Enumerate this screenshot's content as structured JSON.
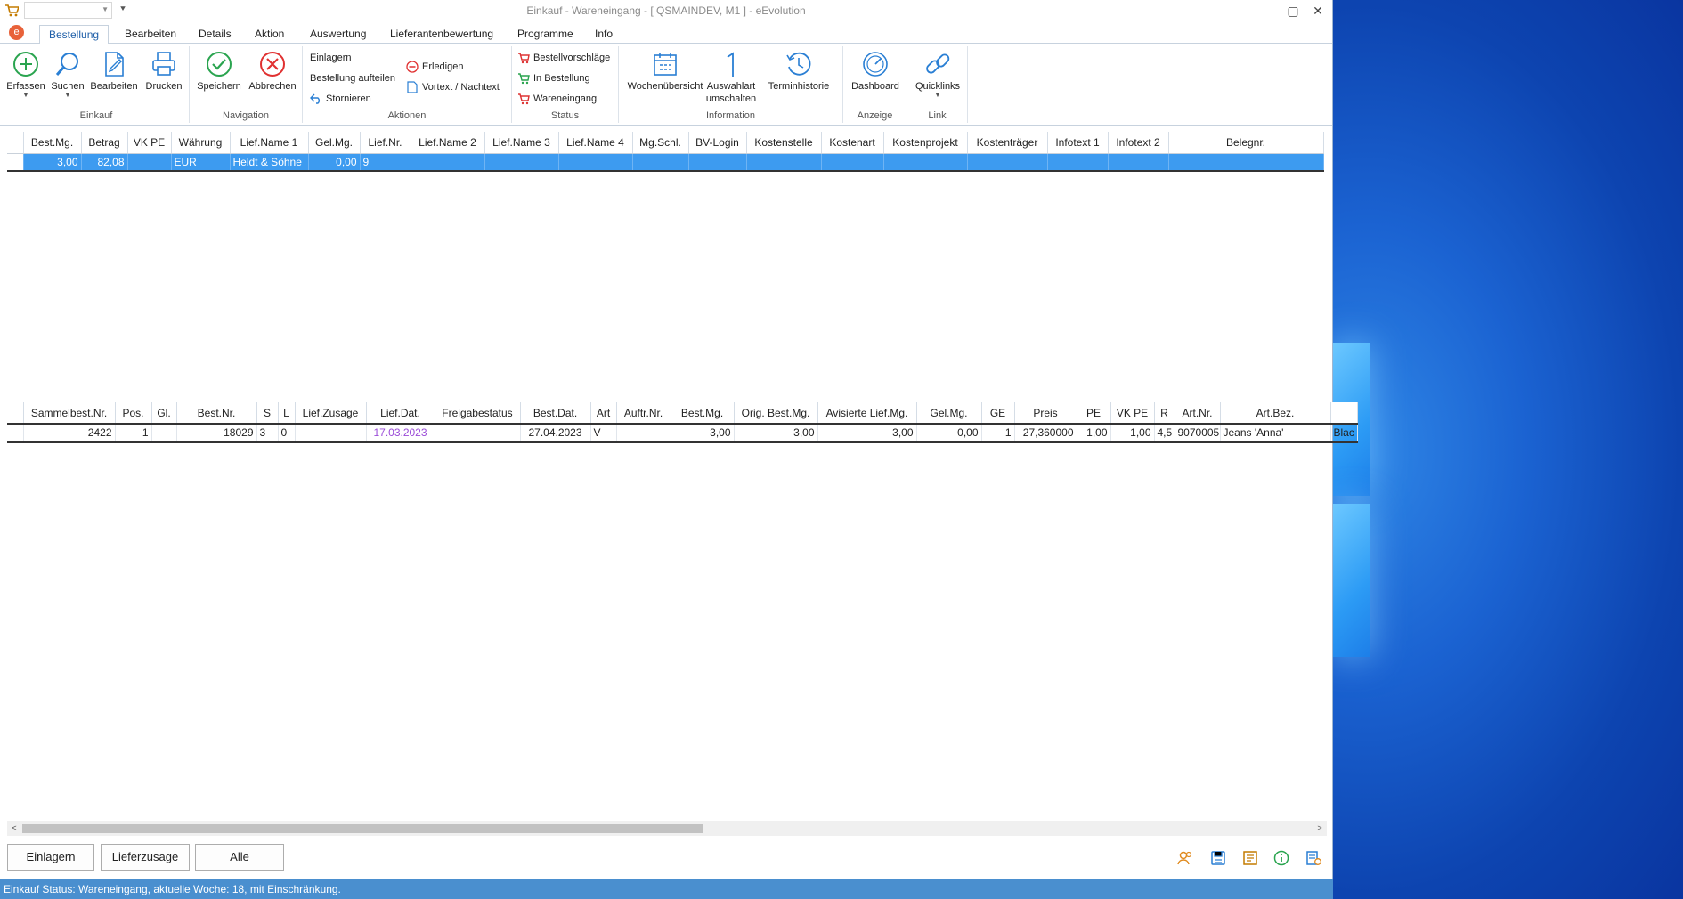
{
  "window": {
    "title": "Einkauf - Wareneingang - [ QSMAINDEV, M1 ]  -  eEvolution",
    "min": "—",
    "max": "▢",
    "close": "✕"
  },
  "qat": {
    "combo_value": ""
  },
  "tabs": [
    {
      "label": "Bestellung",
      "active": true
    },
    {
      "label": "Bearbeiten"
    },
    {
      "label": "Details"
    },
    {
      "label": "Aktion"
    },
    {
      "label": "Auswertung"
    },
    {
      "label": "Lieferantenbewertung"
    },
    {
      "label": "Programme"
    },
    {
      "label": "Info"
    }
  ],
  "ribbon": {
    "einkauf": {
      "label": "Einkauf",
      "erfassen": "Erfassen",
      "suchen": "Suchen",
      "bearbeiten": "Bearbeiten",
      "drucken": "Drucken"
    },
    "navigation": {
      "label": "Navigation",
      "speichern": "Speichern",
      "abbrechen": "Abbrechen"
    },
    "aktionen": {
      "label": "Aktionen",
      "einlagern": "Einlagern",
      "aufteilen": "Bestellung aufteilen",
      "stornieren": "Stornieren",
      "erledigen": "Erledigen",
      "vortext": "Vortext / Nachtext"
    },
    "status": {
      "label": "Status",
      "vorschlaege": "Bestellvorschläge",
      "in_bestellung": "In Bestellung",
      "wareneingang": "Wareneingang"
    },
    "information": {
      "label": "Information",
      "wochen": "Wochenübersicht",
      "auswahlart_1": "Auswahlart",
      "auswahlart_2": "umschalten",
      "termin": "Terminhistorie"
    },
    "anzeige": {
      "label": "Anzeige",
      "dashboard": "Dashboard"
    },
    "link": {
      "label": "Link",
      "quicklinks": "Quicklinks"
    }
  },
  "top_grid": {
    "columns": [
      "Best.Mg.",
      "Betrag",
      "VK PE",
      "Währung",
      "Lief.Name 1",
      "Gel.Mg.",
      "Lief.Nr.",
      "Lief.Name 2",
      "Lief.Name 3",
      "Lief.Name 4",
      "Mg.Schl.",
      "BV-Login",
      "Kostenstelle",
      "Kostenart",
      "Kostenprojekt",
      "Kostenträger",
      "Infotext 1",
      "Infotext 2",
      "Belegnr."
    ],
    "row": [
      "3,00",
      "82,08",
      "",
      "EUR",
      "Heldt & Söhne",
      "0,00",
      "9",
      "",
      "",
      "",
      "",
      "",
      "",
      "",
      "",
      "",
      "",
      "",
      ""
    ]
  },
  "bottom_grid": {
    "columns": [
      "Sammelbest.Nr.",
      "Pos.",
      "Gl.",
      "Best.Nr.",
      "S",
      "L",
      "Lief.Zusage",
      "Lief.Dat.",
      "Freigabestatus",
      "Best.Dat.",
      "Art",
      "Auftr.Nr.",
      "Best.Mg.",
      "Orig. Best.Mg.",
      "Avisierte Lief.Mg.",
      "Gel.Mg.",
      "GE",
      "Preis",
      "PE",
      "VK PE",
      "R",
      "Art.Nr.",
      "Art.Bez.",
      ""
    ],
    "row": [
      "2422",
      "1",
      "",
      "18029",
      "3",
      "0",
      "",
      "17.03.2023",
      "",
      "27.04.2023",
      "V",
      "",
      "3,00",
      "3,00",
      "3,00",
      "0,00",
      "1",
      "27,360000",
      "1,00",
      "1,00",
      "4,5",
      "9070005",
      "Jeans 'Anna'",
      "Blac"
    ]
  },
  "footer": {
    "einlagern": "Einlagern",
    "lieferzusage": "Lieferzusage",
    "alle": "Alle"
  },
  "statusbar": {
    "text": "Einkauf Status: Wareneingang, aktuelle Woche: 18, mit Einschränkung."
  },
  "colors": {
    "selection": "#3d9bf0",
    "statusbar": "#4a8fcf",
    "lilac_date": "#9b4cd8"
  }
}
